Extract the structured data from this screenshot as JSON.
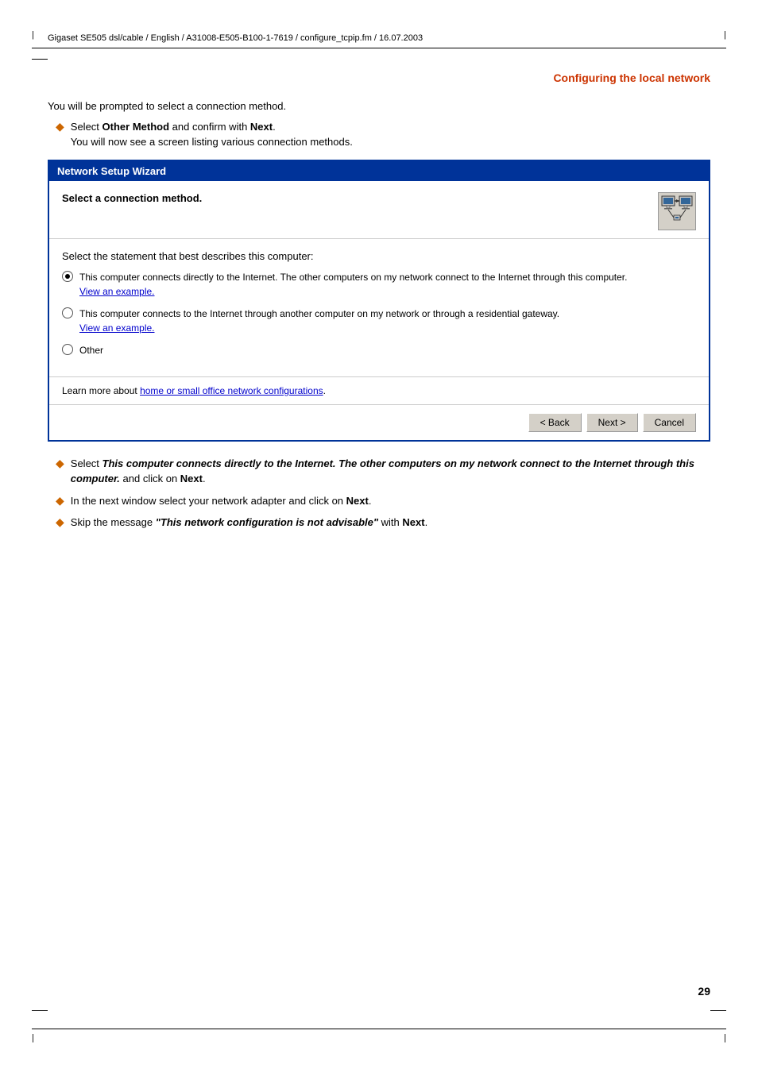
{
  "header": {
    "pipe_left": "|",
    "text": "Gigaset SE505 dsl/cable / English / A31008-E505-B100-1-7619 / configure_tcpip.fm / 16.07.2003",
    "pipe_right": "|"
  },
  "section_title": "Configuring the local network",
  "intro_text": "You will be prompted to select a connection method.",
  "bullet1": {
    "text_before": "Select ",
    "bold_text": "Other Method",
    "text_after": " and confirm with ",
    "bold_next": "Next",
    "text_end": ".",
    "sub_text": "You will now see a screen listing various connection methods."
  },
  "wizard": {
    "title": "Network Setup Wizard",
    "subtitle": "Select a connection method.",
    "body_label": "Select the statement that best describes this computer:",
    "options": [
      {
        "id": "opt1",
        "selected": true,
        "text": "This computer connects directly to the Internet. The other computers on my network connect to the Internet through this computer.",
        "link": "View an example."
      },
      {
        "id": "opt2",
        "selected": false,
        "text": "This computer connects to the Internet through another computer on my network or through a residential gateway.",
        "link": "View an example."
      },
      {
        "id": "opt3",
        "selected": false,
        "text": "Other",
        "link": ""
      }
    ],
    "footer_text_before": "Learn more about ",
    "footer_link": "home or small office network configurations",
    "footer_text_after": ".",
    "buttons": {
      "back": "< Back",
      "next": "Next >",
      "cancel": "Cancel"
    }
  },
  "bullet2": {
    "bold_text": "This computer connects directly to the Internet. The other computers on my network connect to the Internet through this computer.",
    "text_after": " and click on ",
    "bold_next": "Next",
    "text_end": "."
  },
  "bullet3": {
    "text_before": "In the next window select your network adapter and click on ",
    "bold_text": "Next",
    "text_end": "."
  },
  "bullet4": {
    "text_before": "Skip the message ",
    "italic_text": "\"This network configuration is not advisable\"",
    "text_after": " with ",
    "bold_text": "Next",
    "text_end": "."
  },
  "page_number": "29",
  "footer": {
    "pipe_left": "|",
    "pipe_right": "|"
  }
}
